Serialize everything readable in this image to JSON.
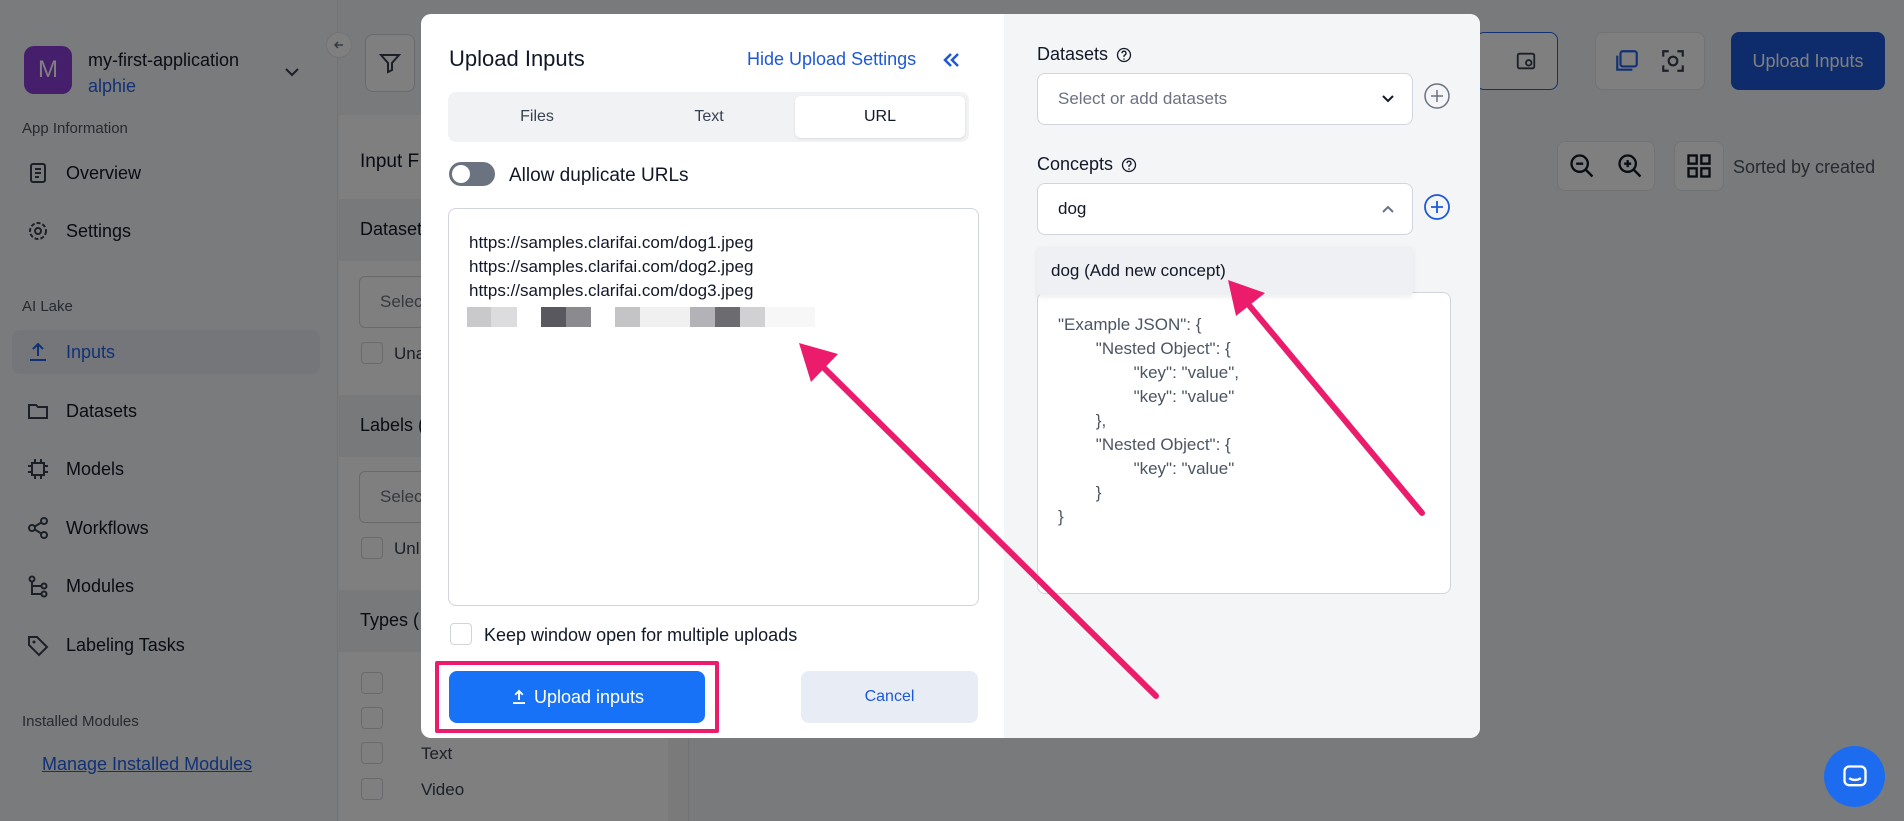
{
  "app": {
    "avatar_letter": "M",
    "name": "my-first-application",
    "user": "alphie"
  },
  "sidebar": {
    "app_info_label": "App Information",
    "ai_lake_label": "AI Lake",
    "installed_modules_label": "Installed Modules",
    "items": [
      {
        "label": "Overview",
        "icon": "document-icon"
      },
      {
        "label": "Settings",
        "icon": "gear-icon"
      },
      {
        "label": "Inputs",
        "icon": "upload-icon",
        "active": true
      },
      {
        "label": "Datasets",
        "icon": "folder-icon"
      },
      {
        "label": "Models",
        "icon": "cpu-icon"
      },
      {
        "label": "Workflows",
        "icon": "share-icon"
      },
      {
        "label": "Modules",
        "icon": "modules-icon"
      },
      {
        "label": "Labeling Tasks",
        "icon": "tag-icon"
      }
    ],
    "manage_link": "Manage Installed Modules"
  },
  "filters": {
    "title": "Input F",
    "datasets_label": "Dataset",
    "datasets_placeholder": "Selec",
    "unassigned_label": "Una",
    "labels_label": "Labels (",
    "labels_placeholder": "Selec",
    "unlabeled_label": "Unl",
    "types_label": "Types (",
    "type_text": "Text",
    "type_video": "Video"
  },
  "toolbar": {
    "upload_label": "Upload Inputs",
    "sort_label": "Sorted by created"
  },
  "modal": {
    "title": "Upload Inputs",
    "hide_settings": "Hide Upload Settings",
    "tabs": [
      "Files",
      "Text",
      "URL"
    ],
    "active_tab": "URL",
    "allow_duplicates_label": "Allow duplicate URLs",
    "urls": [
      "https://samples.clarifai.com/dog1.jpeg",
      "https://samples.clarifai.com/dog2.jpeg",
      "https://samples.clarifai.com/dog3.jpeg"
    ],
    "keep_open_label": "Keep window open for multiple uploads",
    "upload_button": "Upload inputs",
    "cancel_button": "Cancel",
    "datasets_label": "Datasets",
    "datasets_placeholder": "Select or add datasets",
    "concepts_label": "Concepts",
    "concept_value": "dog",
    "concept_suggestion": "dog (Add new concept)",
    "json_example": [
      "\"Example JSON\": {",
      "        \"Nested Object\": {",
      "                \"key\": \"value\",",
      "                \"key\": \"value\"",
      "        },",
      "        \"Nested Object\": {",
      "                \"key\": \"value\"",
      "        }",
      "}"
    ]
  },
  "colors": {
    "primary": "#1872f7",
    "annotation": "#ec1c6c",
    "avatar": "#8b3fd6"
  }
}
